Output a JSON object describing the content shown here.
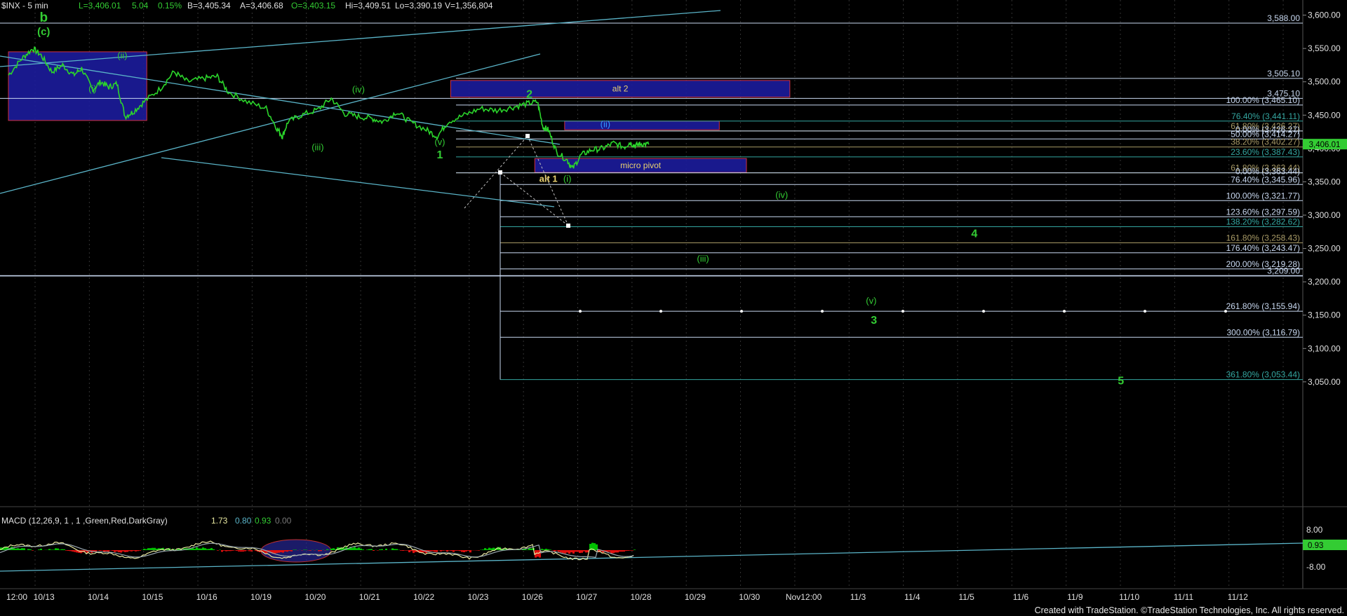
{
  "header": {
    "symbol": "$INX - 5 min",
    "last": "L=3,406.01",
    "change": "5.04",
    "change_pct": "0.15%",
    "bid": "B=3,405.34",
    "ask": "A=3,406.68",
    "open": "O=3,403.15",
    "high": "Hi=3,409.51",
    "low": "Lo=3,390.19",
    "volume": "V=1,356,804"
  },
  "macd": {
    "label": "MACD (12,26,9, 1 , 1 ,Green,Red,DarkGray)",
    "v1": "1.73",
    "v2": "0.80",
    "v3": "0.93",
    "v4": "0.00",
    "axis": [
      "8.00",
      "-8.00"
    ],
    "last_badge": "0.93",
    "colors": {
      "hist_pos": "#00c000",
      "hist_neg": "#e01010",
      "line1": "#e8e8a0",
      "line2": "#a0a0a0"
    }
  },
  "footer": "Created with TradeStation. ©TradeStation Technologies, Inc. All rights reserved.",
  "chart_data": {
    "type": "line",
    "title": "$INX - 5 min",
    "ylim": [
      3035,
      3610
    ],
    "y_ticks": [
      "3,600.00",
      "3,550.00",
      "3,500.00",
      "3,450.00",
      "3,400.00",
      "3,350.00",
      "3,300.00",
      "3,250.00",
      "3,200.00",
      "3,150.00",
      "3,100.00",
      "3,050.00"
    ],
    "y_tick_values": [
      3600,
      3550,
      3500,
      3450,
      3400,
      3350,
      3300,
      3250,
      3200,
      3150,
      3100,
      3050
    ],
    "x_labels": [
      "12:00",
      "10/13",
      "10/14",
      "10/15",
      "10/16",
      "10/19",
      "10/20",
      "10/21",
      "10/22",
      "10/23",
      "10/26",
      "10/27",
      "10/28",
      "10/29",
      "10/30",
      "Nov12:00",
      "11/3",
      "11/4",
      "11/5",
      "11/6",
      "11/9",
      "11/10",
      "11/11",
      "11/12"
    ],
    "x_index": [
      0,
      0.5,
      1.5,
      2.5,
      3.5,
      4.5,
      5.5,
      6.5,
      7.5,
      8.5,
      9.5,
      10.5,
      11.5,
      12.5,
      13.5,
      14.5,
      15.5,
      16.5,
      17.5,
      18.5,
      19.5,
      20.5,
      21.5,
      22.5
    ],
    "last_price": "3,406.01",
    "last_price_value": 3406.01,
    "price_path": [
      [
        0,
        3510
      ],
      [
        0.25,
        3535
      ],
      [
        0.45,
        3550
      ],
      [
        0.6,
        3540
      ],
      [
        0.8,
        3515
      ],
      [
        1.0,
        3525
      ],
      [
        1.2,
        3510
      ],
      [
        1.35,
        3520
      ],
      [
        1.55,
        3488
      ],
      [
        1.7,
        3500
      ],
      [
        1.85,
        3492
      ],
      [
        2.0,
        3497
      ],
      [
        2.15,
        3448
      ],
      [
        2.3,
        3455
      ],
      [
        2.5,
        3470
      ],
      [
        2.8,
        3490
      ],
      [
        3.05,
        3515
      ],
      [
        3.3,
        3500
      ],
      [
        3.6,
        3505
      ],
      [
        3.85,
        3508
      ],
      [
        4.05,
        3485
      ],
      [
        4.4,
        3470
      ],
      [
        4.75,
        3460
      ],
      [
        4.95,
        3430
      ],
      [
        5.05,
        3418
      ],
      [
        5.15,
        3440
      ],
      [
        5.4,
        3450
      ],
      [
        5.7,
        3458
      ],
      [
        5.95,
        3475
      ],
      [
        6.2,
        3452
      ],
      [
        6.45,
        3448
      ],
      [
        6.7,
        3445
      ],
      [
        6.9,
        3440
      ],
      [
        7.15,
        3455
      ],
      [
        7.4,
        3440
      ],
      [
        7.7,
        3428
      ],
      [
        7.9,
        3418
      ],
      [
        8.1,
        3440
      ],
      [
        8.4,
        3450
      ],
      [
        8.7,
        3460
      ],
      [
        9.0,
        3457
      ],
      [
        9.3,
        3462
      ],
      [
        9.55,
        3467
      ],
      [
        9.75,
        3470
      ],
      [
        9.85,
        3432
      ],
      [
        9.95,
        3428
      ],
      [
        10.1,
        3395
      ],
      [
        10.3,
        3382
      ],
      [
        10.4,
        3370
      ],
      [
        10.55,
        3390
      ],
      [
        10.75,
        3398
      ],
      [
        10.95,
        3400
      ],
      [
        11.15,
        3408
      ],
      [
        11.35,
        3402
      ],
      [
        11.45,
        3409
      ],
      [
        11.55,
        3404
      ],
      [
        11.65,
        3407
      ],
      [
        11.8,
        3406
      ]
    ],
    "levels": [
      {
        "label": "3,588.00",
        "value": 3588.0,
        "color": "#c8d8f0"
      },
      {
        "label": "3,505.10",
        "value": 3505.1,
        "color": "#c8d8f0"
      },
      {
        "label": "3,475.10",
        "value": 3475.1,
        "color": "#c8d8f0"
      },
      {
        "label": "100.00% (3,465.10)",
        "value": 3465.1,
        "color": "#c8d8f0"
      },
      {
        "label": "76.40% (3,441.11)",
        "value": 3441.11,
        "color": "#34a6a0"
      },
      {
        "label": "61.80% (3,426.27)",
        "value": 3426.27,
        "color": "#a89a66"
      },
      {
        "label": "0.00% (3,426.27)",
        "value": 3426.27,
        "color": "#c8d8f0"
      },
      {
        "label": "50.00% (3,414.27)",
        "value": 3414.27,
        "color": "#c8d8f0"
      },
      {
        "label": "38.20% (3,402.27)",
        "value": 3402.27,
        "color": "#a89a66"
      },
      {
        "label": "23.60% (3,387.43)",
        "value": 3387.43,
        "color": "#34a6a0"
      },
      {
        "label": "61.80% (3,363.44)",
        "value": 3363.44,
        "color": "#a89a66"
      },
      {
        "label": "0.00% (3,363.44)",
        "value": 3363.44,
        "color": "#c8d8f0"
      },
      {
        "label": "76.40% (3,345.96)",
        "value": 3345.96,
        "color": "#c8d8f0"
      },
      {
        "label": "100.00% (3,321.77)",
        "value": 3321.77,
        "color": "#c8d8f0"
      },
      {
        "label": "123.60% (3,297.59)",
        "value": 3297.59,
        "color": "#c8d8f0"
      },
      {
        "label": "138.20% (3,282.62)",
        "value": 3282.62,
        "color": "#34a6a0"
      },
      {
        "label": "161.80% (3,258.43)",
        "value": 3258.43,
        "color": "#a89a66"
      },
      {
        "label": "176.40% (3,243.47)",
        "value": 3243.47,
        "color": "#c8d8f0"
      },
      {
        "label": "200.00% (3,219.28)",
        "value": 3219.28,
        "color": "#c8d8f0"
      },
      {
        "label": "3,209.00",
        "value": 3209.0,
        "color": "#c8d8f0"
      },
      {
        "label": "261.80% (3,155.94)",
        "value": 3155.94,
        "color": "#c8d8f0"
      },
      {
        "label": "300.00% (3,116.79)",
        "value": 3116.79,
        "color": "#c8d8f0"
      },
      {
        "label": "361.80% (3,053.44)",
        "value": 3053.44,
        "color": "#34a6a0"
      }
    ],
    "zones": [
      {
        "label": "",
        "x0": 0,
        "x1": 2.55,
        "y0": 3442,
        "y1": 3545
      },
      {
        "label": "alt 2",
        "x0": 8.15,
        "x1": 14.4,
        "y0": 3477,
        "y1": 3502
      },
      {
        "label": "",
        "x0": 10.25,
        "x1": 13.1,
        "y0": 3428,
        "y1": 3441
      },
      {
        "label": "micro pivot",
        "x0": 9.7,
        "x1": 13.6,
        "y0": 3364,
        "y1": 3385
      }
    ],
    "wave_labels": [
      {
        "text": "b",
        "x": 0.65,
        "y": 3590,
        "color": "#33cc33",
        "size": 19,
        "bold": true
      },
      {
        "text": "(c)",
        "x": 0.65,
        "y": 3570,
        "color": "#33cc33",
        "size": 15,
        "bold": true
      },
      {
        "text": "(ii)",
        "x": 2.1,
        "y": 3535,
        "color": "#33cc33",
        "size": 13
      },
      {
        "text": "(i)",
        "x": 1.55,
        "y": 3485,
        "color": "#33cc33",
        "size": 13
      },
      {
        "text": "(iv)",
        "x": 6.45,
        "y": 3484,
        "color": "#33cc33",
        "size": 13
      },
      {
        "text": "(iii)",
        "x": 5.7,
        "y": 3397,
        "color": "#33cc33",
        "size": 13
      },
      {
        "text": "(v)",
        "x": 7.95,
        "y": 3405,
        "color": "#33cc33",
        "size": 13
      },
      {
        "text": "1",
        "x": 7.95,
        "y": 3385,
        "color": "#33cc33",
        "size": 16,
        "bold": true
      },
      {
        "text": "2",
        "x": 9.6,
        "y": 3476,
        "color": "#33cc33",
        "size": 16,
        "bold": true
      },
      {
        "text": "(ii)",
        "x": 11.0,
        "y": 3432,
        "color": "#3399ff",
        "size": 13
      },
      {
        "text": "alt 1",
        "x": 9.95,
        "y": 3350,
        "color": "#e8d070",
        "size": 13,
        "bold": true
      },
      {
        "text": "(i)",
        "x": 10.3,
        "y": 3350,
        "color": "#33cc33",
        "size": 13
      },
      {
        "text": "(iv)",
        "x": 14.25,
        "y": 3326,
        "color": "#33cc33",
        "size": 13
      },
      {
        "text": "4",
        "x": 17.8,
        "y": 3267,
        "color": "#33cc33",
        "size": 16,
        "bold": true
      },
      {
        "text": "(iii)",
        "x": 12.8,
        "y": 3230,
        "color": "#33cc33",
        "size": 13
      },
      {
        "text": "(v)",
        "x": 15.9,
        "y": 3167,
        "color": "#33cc33",
        "size": 13
      },
      {
        "text": "3",
        "x": 15.95,
        "y": 3137,
        "color": "#33cc33",
        "size": 16,
        "bold": true
      },
      {
        "text": "5",
        "x": 20.5,
        "y": 3046,
        "color": "#33cc33",
        "size": 16,
        "bold": true
      }
    ]
  }
}
